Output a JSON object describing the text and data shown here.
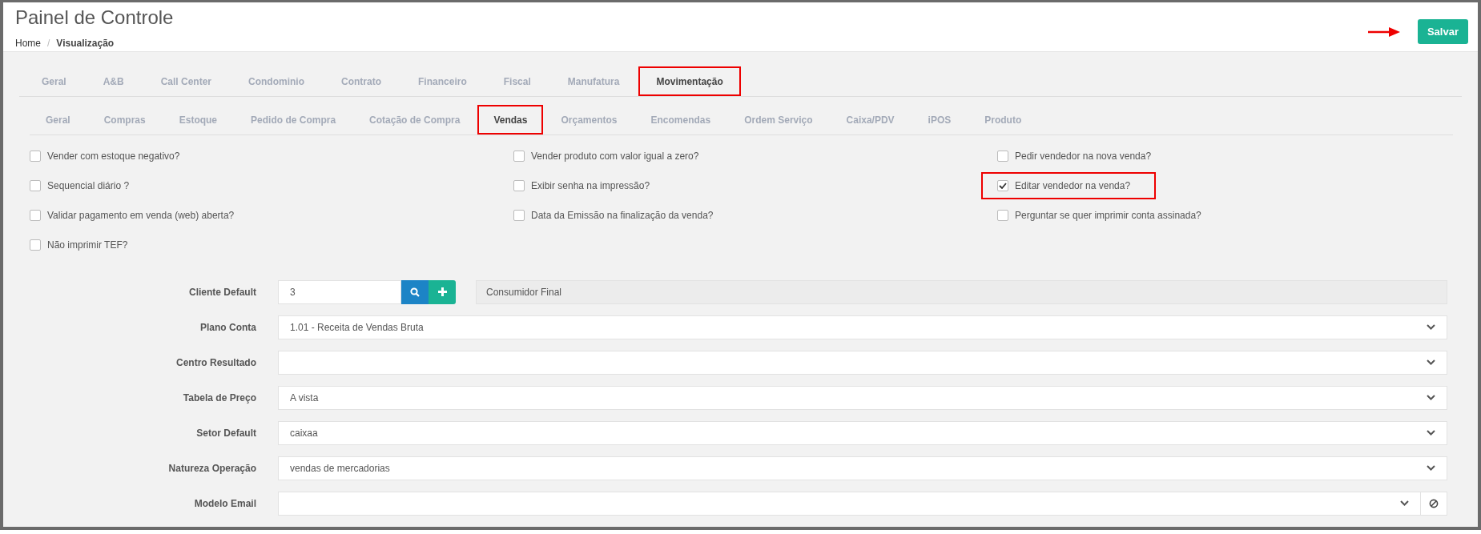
{
  "header": {
    "title": "Painel de Controle",
    "breadcrumb": [
      {
        "label": "Home",
        "current": false
      },
      {
        "label": "Visualização",
        "current": true
      }
    ],
    "breadcrumb_separator": "/",
    "save_button": "Salvar"
  },
  "tabs": [
    {
      "label": "Geral",
      "selected": false,
      "highlighted": false
    },
    {
      "label": "A&B",
      "selected": false,
      "highlighted": false
    },
    {
      "label": "Call Center",
      "selected": false,
      "highlighted": false
    },
    {
      "label": "Condominio",
      "selected": false,
      "highlighted": false
    },
    {
      "label": "Contrato",
      "selected": false,
      "highlighted": false
    },
    {
      "label": "Financeiro",
      "selected": false,
      "highlighted": false
    },
    {
      "label": "Fiscal",
      "selected": false,
      "highlighted": false
    },
    {
      "label": "Manufatura",
      "selected": false,
      "highlighted": false
    },
    {
      "label": "Movimentação",
      "selected": true,
      "highlighted": true
    }
  ],
  "subtabs": [
    {
      "label": "Geral",
      "selected": false,
      "highlighted": false
    },
    {
      "label": "Compras",
      "selected": false,
      "highlighted": false
    },
    {
      "label": "Estoque",
      "selected": false,
      "highlighted": false
    },
    {
      "label": "Pedido de Compra",
      "selected": false,
      "highlighted": false
    },
    {
      "label": "Cotação de Compra",
      "selected": false,
      "highlighted": false
    },
    {
      "label": "Vendas",
      "selected": true,
      "highlighted": true
    },
    {
      "label": "Orçamentos",
      "selected": false,
      "highlighted": false
    },
    {
      "label": "Encomendas",
      "selected": false,
      "highlighted": false
    },
    {
      "label": "Ordem Serviço",
      "selected": false,
      "highlighted": false
    },
    {
      "label": "Caixa/PDV",
      "selected": false,
      "highlighted": false
    },
    {
      "label": "iPOS",
      "selected": false,
      "highlighted": false
    },
    {
      "label": "Produto",
      "selected": false,
      "highlighted": false
    }
  ],
  "options": [
    {
      "label": "Vender com estoque negativo?",
      "checked": false,
      "highlighted": false
    },
    {
      "label": "Vender produto com valor igual a zero?",
      "checked": false,
      "highlighted": false
    },
    {
      "label": "Pedir vendedor na nova venda?",
      "checked": false,
      "highlighted": false
    },
    {
      "label": "Sequencial diário ?",
      "checked": false,
      "highlighted": false
    },
    {
      "label": "Exibir senha na impressão?",
      "checked": false,
      "highlighted": false
    },
    {
      "label": "Editar vendedor na venda?",
      "checked": true,
      "highlighted": true
    },
    {
      "label": "Validar pagamento em venda (web) aberta?",
      "checked": false,
      "highlighted": false
    },
    {
      "label": "Data da Emissão na finalização da venda?",
      "checked": false,
      "highlighted": false
    },
    {
      "label": "Perguntar se quer imprimir conta assinada?",
      "checked": false,
      "highlighted": false
    },
    {
      "label": "Não imprimir TEF?",
      "checked": false,
      "highlighted": false
    }
  ],
  "fields": [
    {
      "kind": "lookup",
      "label": "Cliente Default",
      "value": "3",
      "description": "Consumidor Final"
    },
    {
      "kind": "select",
      "label": "Plano Conta",
      "value": "1.01 - Receita de Vendas Bruta"
    },
    {
      "kind": "select",
      "label": "Centro Resultado"
    },
    {
      "kind": "select",
      "label": "Tabela de Preço",
      "value": "A vista"
    },
    {
      "kind": "select",
      "label": "Setor Default",
      "value": "caixaa"
    },
    {
      "kind": "select",
      "label": "Natureza Operação",
      "value": "vendas de mercadorias"
    },
    {
      "kind": "select-clear",
      "label": "Modelo Email"
    }
  ]
}
